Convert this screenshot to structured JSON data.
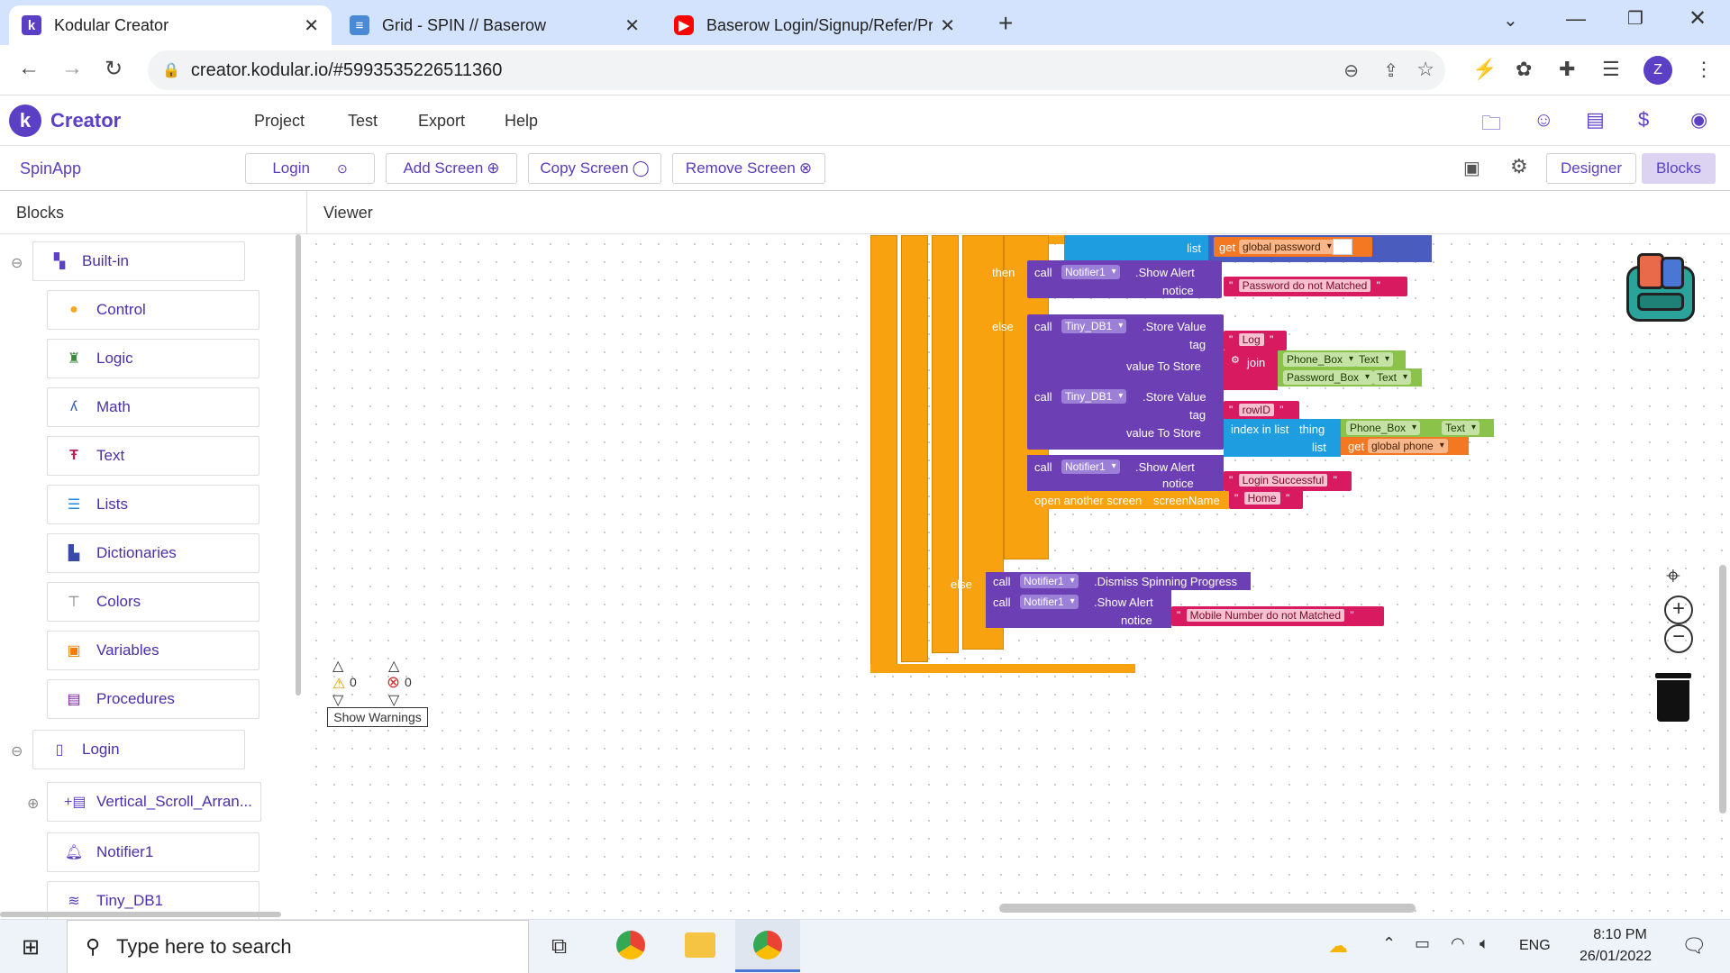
{
  "browser": {
    "tabs": [
      {
        "title": "Kodular Creator",
        "favicon": "kodular-icon",
        "color": "#5b3fc4"
      },
      {
        "title": "Grid - SPIN // Baserow",
        "favicon": "baserow-icon",
        "color": "#4a8ad4"
      },
      {
        "title": "Baserow Login/Signup/Refer/Pro",
        "favicon": "youtube-icon",
        "color": "#ff0000"
      }
    ],
    "url": "creator.kodular.io/#5993535226511360",
    "profile_initial": "Z"
  },
  "app": {
    "logo_text": "Creator",
    "menu": [
      "Project",
      "Test",
      "Export",
      "Help"
    ],
    "project_name": "SpinApp",
    "screen_selector": "Login",
    "add_screen": "Add Screen",
    "copy_screen": "Copy Screen",
    "remove_screen": "Remove Screen",
    "designer": "Designer",
    "blocks": "Blocks"
  },
  "sidebar": {
    "title": "Blocks",
    "builtin_label": "Built-in",
    "builtin": [
      {
        "label": "Control",
        "icon": "control-icon",
        "color": "#f5a623"
      },
      {
        "label": "Logic",
        "icon": "logic-icon",
        "color": "#3c8a3c"
      },
      {
        "label": "Math",
        "icon": "math-icon",
        "color": "#2f56b0"
      },
      {
        "label": "Text",
        "icon": "text-icon",
        "color": "#c2185b"
      },
      {
        "label": "Lists",
        "icon": "lists-icon",
        "color": "#1e88e5"
      },
      {
        "label": "Dictionaries",
        "icon": "dictionaries-icon",
        "color": "#3949ab"
      },
      {
        "label": "Colors",
        "icon": "colors-icon",
        "color": "#757575"
      },
      {
        "label": "Variables",
        "icon": "variables-icon",
        "color": "#f57c00"
      },
      {
        "label": "Procedures",
        "icon": "procedures-icon",
        "color": "#7b1fa2"
      }
    ],
    "screen_label": "Login",
    "components": [
      {
        "label": "Vertical_Scroll_Arran...",
        "icon": "vertical-scroll-icon"
      },
      {
        "label": "Notifier1",
        "icon": "notifier-icon"
      },
      {
        "label": "Tiny_DB1",
        "icon": "database-icon"
      }
    ]
  },
  "viewer": {
    "title": "Viewer",
    "warnings_count": "0",
    "errors_count": "0",
    "show_warnings": "Show Warnings"
  },
  "blocks": {
    "list_kw": "list",
    "get_kw": "get",
    "global_password": "global password",
    "then_kw": "then",
    "else_kw": "else",
    "call_kw": "call",
    "notifier1": "Notifier1",
    "show_alert": ".Show Alert",
    "notice_kw": "notice",
    "pw_not_matched": "Password do not Matched",
    "tinydb1": "Tiny_DB1",
    "store_value": ".Store Value",
    "tag_kw": "tag",
    "value_to_store": "value To Store",
    "log_str": "Log",
    "join_kw": "join",
    "phone_box": "Phone_Box",
    "password_box": "Password_Box",
    "text_prop": "Text",
    "rowid_str": "rowID",
    "index_in_list": "index in list",
    "thing_kw": "thing",
    "global_phone": "global phone",
    "login_successful": "Login Successful",
    "open_screen": "open another screen",
    "screen_name_kw": "screenName",
    "home_str": "Home",
    "dismiss": ".Dismiss Spinning Progress",
    "mobile_not_matched": "Mobile Number do not Matched"
  },
  "taskbar": {
    "search_placeholder": "Type here to search",
    "lang": "ENG",
    "time": "8:10 PM",
    "date": "26/01/2022"
  }
}
